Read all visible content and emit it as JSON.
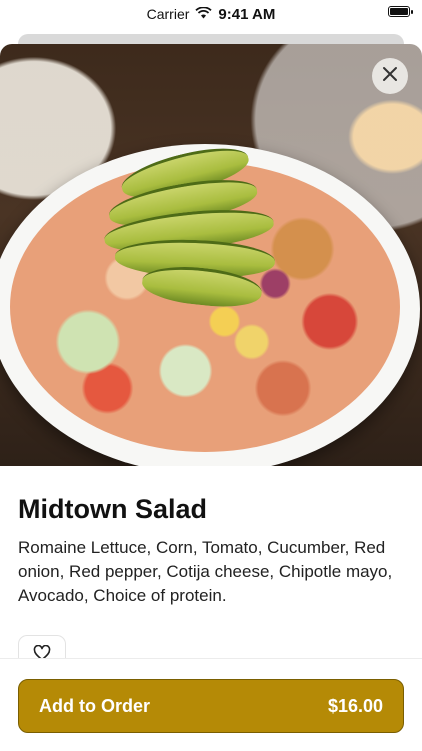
{
  "status_bar": {
    "carrier": "Carrier",
    "time": "9:41 AM",
    "battery_level": 1.0
  },
  "item": {
    "name": "Midtown Salad",
    "description": "Romaine Lettuce, Corn, Tomato, Cucumber, Red onion, Red pepper, Cotija cheese, Chipotle mayo, Avocado, Choice of protein.",
    "image_description": "Photo of a salad bowl with avocado slices, corn, tomato, cucumber and chipotle mayo"
  },
  "actions": {
    "close_icon": "close-icon",
    "favorite_icon": "heart-icon",
    "add_label": "Add to Order",
    "price": "$16.00"
  },
  "colors": {
    "accent": "#b58a06",
    "accent_border": "#7a5e00"
  }
}
